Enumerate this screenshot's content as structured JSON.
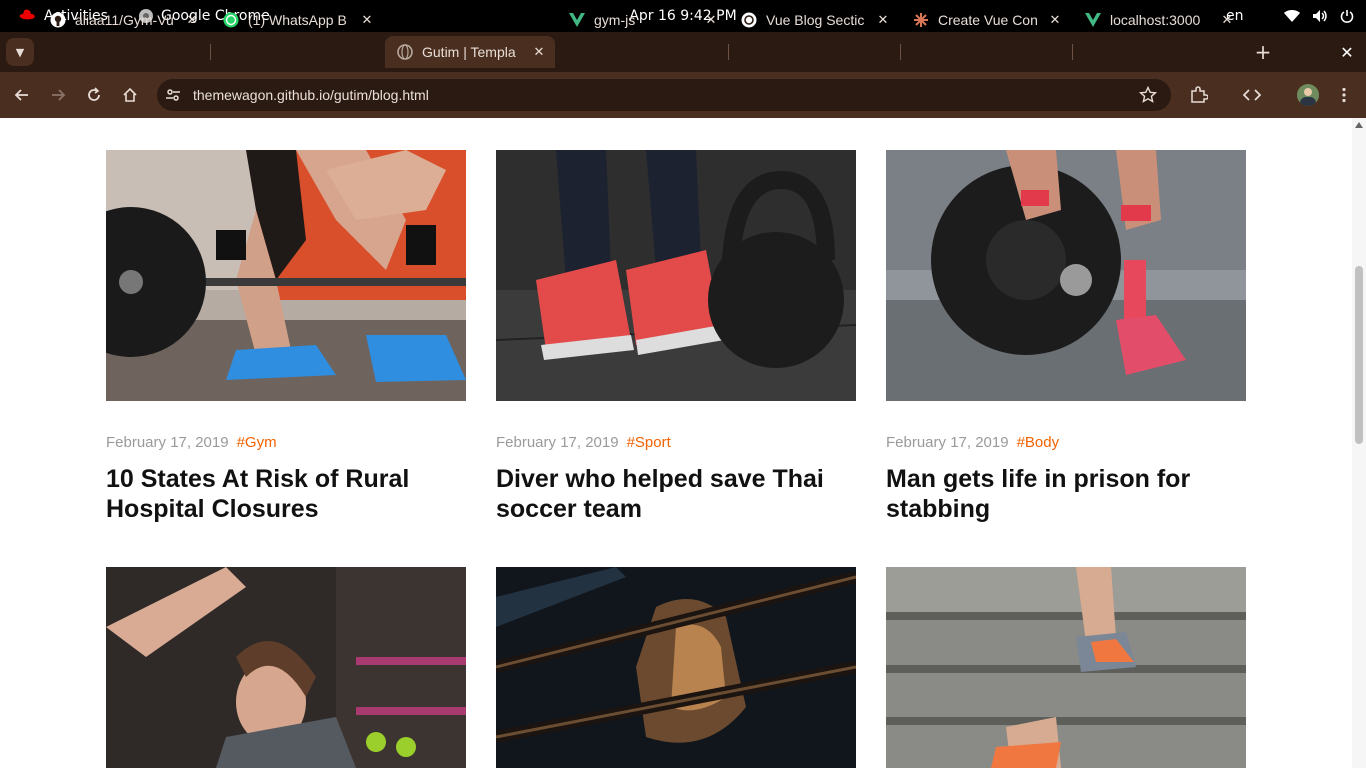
{
  "topbar": {
    "activities": "Activities",
    "app": "Google Chrome",
    "clock": "Apr 16  9:42 PM",
    "lang": "en"
  },
  "tabs": [
    {
      "title": "aliaa11/Gym-Vu",
      "icon": "github-icon"
    },
    {
      "title": "(1) WhatsApp B",
      "icon": "whatsapp-icon"
    },
    {
      "title": "Gutim | Templa",
      "icon": "globe-icon",
      "active": true
    },
    {
      "title": "gym-js",
      "icon": "vue-icon"
    },
    {
      "title": "Vue Blog Sectic",
      "icon": "openai-icon"
    },
    {
      "title": "Create Vue Con",
      "icon": "claude-icon"
    },
    {
      "title": "localhost:3000",
      "icon": "vue-icon"
    }
  ],
  "toolbar": {
    "url": "themewagon.github.io/gutim/blog.html"
  },
  "colors": {
    "accent": "#f36100",
    "chrome_dark": "#2b1a12",
    "chrome_toolbar": "#4a2f21"
  },
  "posts": [
    {
      "date": "February 17, 2019",
      "tag": "#Gym",
      "title": "10 States At Risk of Rural Hospital Closures"
    },
    {
      "date": "February 17, 2019",
      "tag": "#Sport",
      "title": "Diver who helped save Thai soccer team"
    },
    {
      "date": "February 17, 2019",
      "tag": "#Body",
      "title": "Man gets life in prison for stabbing"
    }
  ]
}
